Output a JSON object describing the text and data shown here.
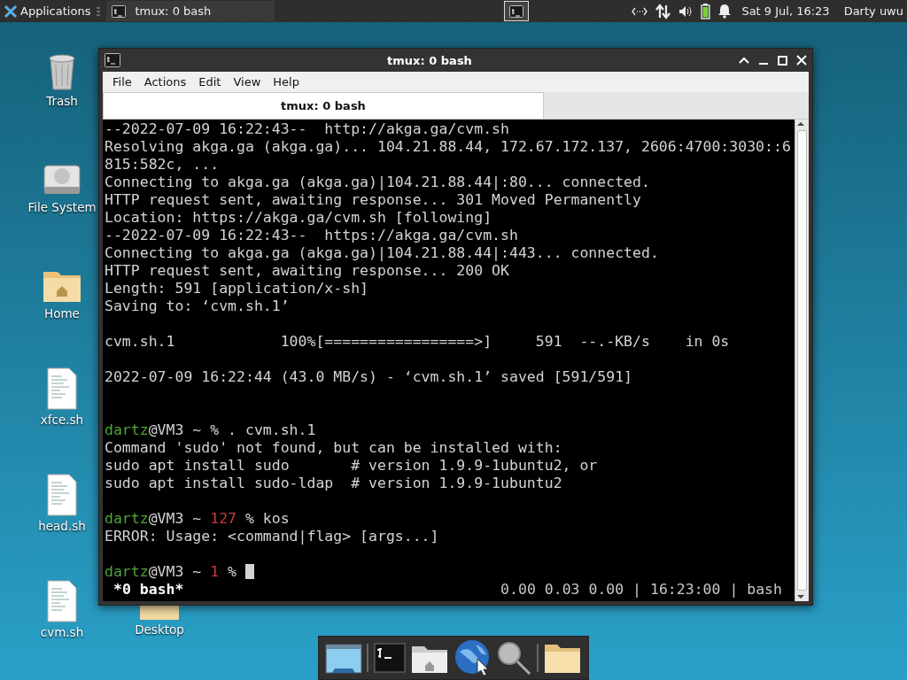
{
  "top_panel": {
    "menu_label": "Applications",
    "tasks": [
      {
        "label": "tmux: 0 bash",
        "selected": false
      }
    ],
    "clock": "Sat  9 Jul, 16:23",
    "user": "Darty uwu"
  },
  "desktop_icons": [
    {
      "label": "Trash",
      "kind": "trash"
    },
    {
      "label": "File System",
      "kind": "drive"
    },
    {
      "label": "Home",
      "kind": "home"
    },
    {
      "label": "xfce.sh",
      "kind": "script"
    },
    {
      "label": "head.sh",
      "kind": "script"
    },
    {
      "label": "cvm.sh",
      "kind": "script"
    }
  ],
  "desktop_second_column": [
    {
      "label": "Desktop",
      "kind": "folder"
    }
  ],
  "window": {
    "title": "tmux: 0 bash",
    "menu": [
      "File",
      "Actions",
      "Edit",
      "View",
      "Help"
    ],
    "tabs": [
      {
        "label": "tmux: 0 bash",
        "selected": true
      }
    ],
    "terminal": {
      "cursor": true,
      "lines": [
        {
          "kind": "text",
          "segments": [
            {
              "text": "--2022-07-09 16:22:43--  http://akga.ga/cvm.sh",
              "kind": "plain"
            }
          ]
        },
        {
          "kind": "text",
          "segments": [
            {
              "text": "Resolving akga.ga (akga.ga)... 104.21.88.44, 172.67.172.137, 2606:4700:3030::6",
              "kind": "plain"
            }
          ]
        },
        {
          "kind": "text",
          "segments": [
            {
              "text": "815:582c, ...",
              "kind": "plain"
            }
          ]
        },
        {
          "kind": "text",
          "segments": [
            {
              "text": "Connecting to akga.ga (akga.ga)|104.21.88.44|:80... connected.",
              "kind": "plain"
            }
          ]
        },
        {
          "kind": "text",
          "segments": [
            {
              "text": "HTTP request sent, awaiting response... 301 Moved Permanently",
              "kind": "plain"
            }
          ]
        },
        {
          "kind": "text",
          "segments": [
            {
              "text": "Location: https://akga.ga/cvm.sh [following]",
              "kind": "plain"
            }
          ]
        },
        {
          "kind": "text",
          "segments": [
            {
              "text": "--2022-07-09 16:22:43--  https://akga.ga/cvm.sh",
              "kind": "plain"
            }
          ]
        },
        {
          "kind": "text",
          "segments": [
            {
              "text": "Connecting to akga.ga (akga.ga)|104.21.88.44|:443... connected.",
              "kind": "plain"
            }
          ]
        },
        {
          "kind": "text",
          "segments": [
            {
              "text": "HTTP request sent, awaiting response... 200 OK",
              "kind": "plain"
            }
          ]
        },
        {
          "kind": "text",
          "segments": [
            {
              "text": "Length: 591 [application/x-sh]",
              "kind": "plain"
            }
          ]
        },
        {
          "kind": "text",
          "segments": [
            {
              "text": "Saving to: ‘cvm.sh.1’",
              "kind": "plain"
            }
          ]
        },
        {
          "kind": "blank"
        },
        {
          "kind": "text",
          "segments": [
            {
              "text": "cvm.sh.1            100%[=================>]     591  --.-KB/s    in 0s",
              "kind": "plain"
            }
          ]
        },
        {
          "kind": "blank"
        },
        {
          "kind": "text",
          "segments": [
            {
              "text": "2022-07-09 16:22:44 (43.0 MB/s) - ‘cvm.sh.1’ saved [591/591]",
              "kind": "plain"
            }
          ]
        },
        {
          "kind": "blank"
        },
        {
          "kind": "blank"
        },
        {
          "kind": "text",
          "segments": [
            {
              "text": "dartz",
              "kind": "user"
            },
            {
              "text": "@VM3 ~ % . cvm.sh.1",
              "kind": "plain"
            }
          ]
        },
        {
          "kind": "text",
          "segments": [
            {
              "text": "Command 'sudo' not found, but can be installed with:",
              "kind": "plain"
            }
          ]
        },
        {
          "kind": "text",
          "segments": [
            {
              "text": "sudo apt install sudo       # version 1.9.9-1ubuntu2, or",
              "kind": "plain"
            }
          ]
        },
        {
          "kind": "text",
          "segments": [
            {
              "text": "sudo apt install sudo-ldap  # version 1.9.9-1ubuntu2",
              "kind": "plain"
            }
          ]
        },
        {
          "kind": "blank"
        },
        {
          "kind": "text",
          "segments": [
            {
              "text": "dartz",
              "kind": "user"
            },
            {
              "text": "@VM3 ~ ",
              "kind": "plain"
            },
            {
              "text": "127",
              "kind": "error"
            },
            {
              "text": " % kos",
              "kind": "plain"
            }
          ]
        },
        {
          "kind": "text",
          "segments": [
            {
              "text": "ERROR: Usage: <command|flag> [args...]",
              "kind": "plain"
            }
          ]
        },
        {
          "kind": "blank"
        },
        {
          "kind": "text",
          "segments": [
            {
              "text": "dartz",
              "kind": "user"
            },
            {
              "text": "@VM3 ~ ",
              "kind": "plain"
            },
            {
              "text": "1",
              "kind": "error"
            },
            {
              "text": " % ",
              "kind": "plain"
            }
          ]
        }
      ],
      "status_left": "*0 bash*",
      "status_right": "0.00 0.03 0.00 | 16:23:00 | bash"
    }
  },
  "dock": [
    {
      "kind": "desktop"
    },
    {
      "kind": "terminal"
    },
    {
      "kind": "home"
    },
    {
      "kind": "globe"
    },
    {
      "kind": "search"
    },
    {
      "kind": "folder"
    }
  ]
}
